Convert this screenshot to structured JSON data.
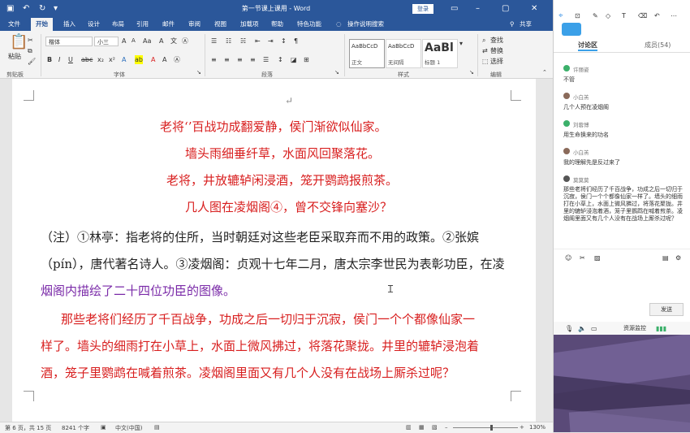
{
  "window": {
    "title": "第一节课上课用 - Word",
    "login_label": "登录"
  },
  "tabs": [
    "文件",
    "开始",
    "插入",
    "设计",
    "布局",
    "引用",
    "邮件",
    "审阅",
    "视图",
    "加载项",
    "帮助",
    "特色功能",
    "操作说明搜索",
    "共享"
  ],
  "ribbon": {
    "clipboard": {
      "paste_label": "粘贴",
      "group_label": "剪贴板"
    },
    "font": {
      "font_name": "楷体",
      "font_size": "小三",
      "group_label": "字体"
    },
    "paragraph": {
      "group_label": "段落"
    },
    "styles": {
      "items": [
        {
          "sample": "AaBbCcD",
          "name": "正文"
        },
        {
          "sample": "AaBbCcD",
          "name": "无间隔"
        },
        {
          "sample": "AaBl",
          "name": "标题 1"
        }
      ],
      "group_label": "样式"
    },
    "editing": {
      "find": "查找",
      "replace": "替换",
      "select": "选择",
      "group_label": "编辑"
    }
  },
  "document": {
    "poem": [
      "老将‘’百战功成翻爱静，侯门渐欲似仙家。",
      "墙头雨细垂纤草，水面风回聚落花。",
      "老将，井放辘轳闲浸酒，笼开鹦鹉报煎茶。",
      "几人图在凌烟阁④，曾不交锋向塞沙？"
    ],
    "note_lines": [
      "（注）①林亭：指老将的住所，当时朝廷对这些老臣采取弃而不用的政策。②张嫔",
      "（pín），唐代著名诗人。③凌烟阁：贞观十七年二月，唐太宗李世民为表彰功臣，在凌",
      "烟阁内描绘了二十四位功臣的图像。"
    ],
    "translation_lines": [
      "那些老将们经历了千百战争，功成之后一切归于沉寂，侯门一个个都像仙家一",
      "样了。墙头的细雨打在小草上，水面上微风拂过，将落花聚拢。井里的辘轳浸泡着",
      "酒，笼子里鹦鹉在喊着煎茶。凌烟阁里面又有几个人没有在战场上厮杀过呢？"
    ]
  },
  "status": {
    "page": "第 6 页，共 15 页",
    "words": "8241 个字",
    "language": "中文(中国)",
    "zoom": "130%"
  },
  "sidebar": {
    "tabs": [
      "讨论区",
      "成员(54)"
    ],
    "messages": [
      {
        "name": "许丽姿",
        "text": "不管"
      },
      {
        "name": "小白羔",
        "text": "几个人预在凌烟阁"
      },
      {
        "name": "刘蓉博",
        "text": "用生命换来的功名"
      },
      {
        "name": "小白羔",
        "text": "我的理解先是反过来了"
      },
      {
        "name": "莫莫莫",
        "text": "那些老将们经历了千百战争，功成之后一切归于沉寂，侯门一个个都像仙家一样了。墙头的细雨打在小草上，水面上微风拂过，将落花聚拢。井里的辘轳浸泡着酒，笼子里鹦鹉在喊着煎茶。凌烟阁里面又有几个人没有在战场上厮杀过呢？"
      }
    ],
    "send_label": "发送",
    "resource_label": "资源监控"
  }
}
